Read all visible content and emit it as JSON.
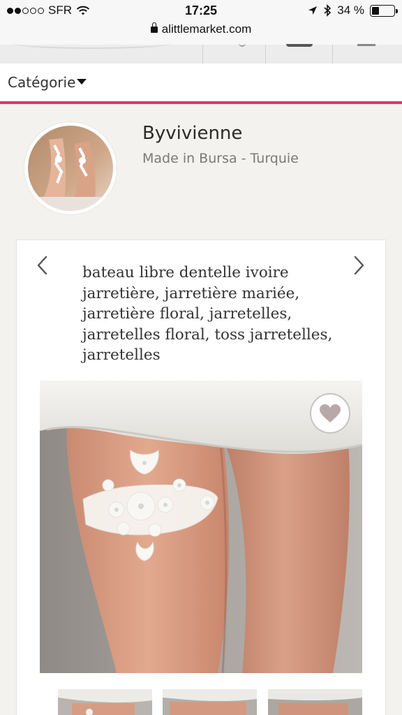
{
  "status_bar": {
    "carrier": "SFR",
    "signal_bars_filled": 2,
    "signal_bars_total": 5,
    "time": "17:25",
    "battery_percent": "34 %",
    "battery_level": 0.34,
    "icons": [
      "wifi-icon",
      "location-arrow-icon",
      "bluetooth-icon",
      "battery-icon"
    ]
  },
  "browser": {
    "url": "alittlemarket.com",
    "lock_icon": "lock-icon"
  },
  "nav": {
    "category_label": "Catégorie",
    "caret_icon": "caret-down-icon",
    "accent_color": "#e1336a"
  },
  "shop": {
    "name": "Byvivienne",
    "origin": "Made in Bursa - Turquie"
  },
  "product": {
    "title": "bateau libre dentelle ivoire jarretière, jarretière mariée, jarretière floral, jarretelles, jarretelles floral, toss jarretelles, jarretelles",
    "prev_icon": "chevron-left-icon",
    "next_icon": "chevron-right-icon",
    "favorite_icon": "heart-icon",
    "thumbnails_visible": 3
  }
}
